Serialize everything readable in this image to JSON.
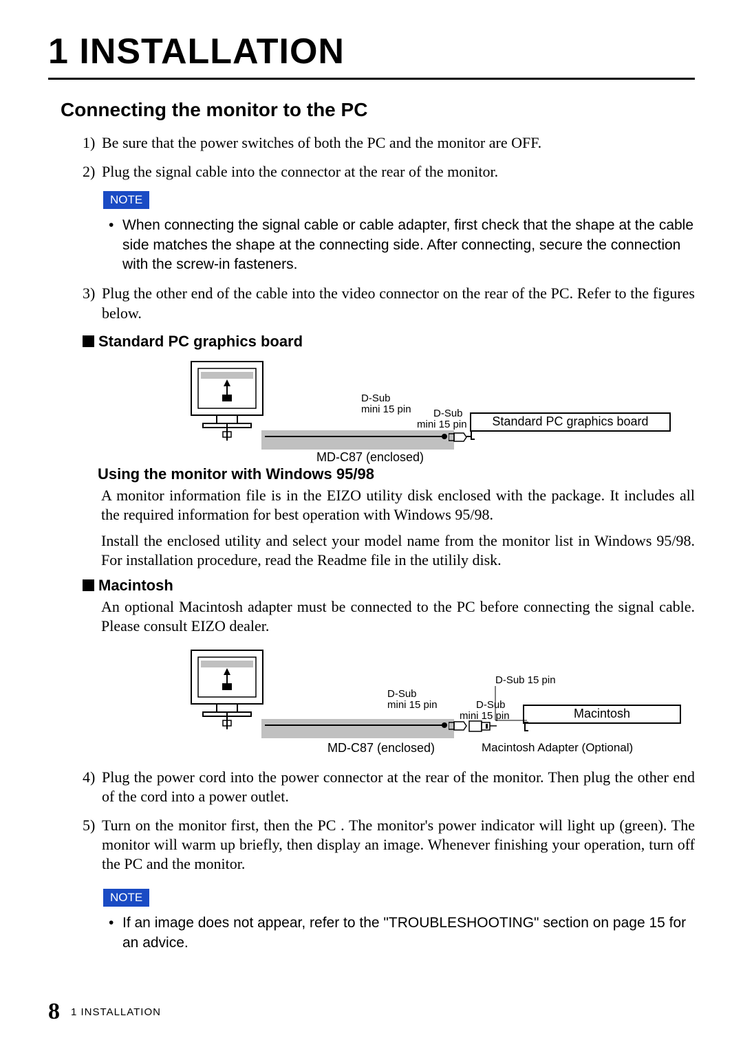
{
  "chapter": {
    "number": "1",
    "title": "INSTALLATION",
    "full": "1 INSTALLATION"
  },
  "section": {
    "heading": "Connecting the monitor to the PC"
  },
  "steps": {
    "s1": {
      "n": "1)",
      "t": "Be sure that the power switches of both the PC and the monitor are OFF."
    },
    "s2": {
      "n": "2)",
      "t": "Plug the signal cable into the connector at the rear of the monitor."
    },
    "s3": {
      "n": "3)",
      "t": "Plug the other end of the cable into the video connector on the rear of the PC.  Refer to the figures below."
    },
    "s4": {
      "n": "4)",
      "t": "Plug the power cord into the power connector at the rear of the monitor.  Then plug the other end of the cord into a power outlet."
    },
    "s5": {
      "n": "5)",
      "t": "Turn on the monitor first, then the PC .  The monitor's power indicator will light up (green).  The monitor will warm up briefly, then display an image.  Whenever finishing your operation, turn off the PC and the monitor."
    }
  },
  "notes": {
    "label": "NOTE",
    "n1": "When connecting the signal cable or cable adapter, first check that the shape at the cable side matches the shape at the connecting side.  After connecting, secure the connection with the screw-in fasteners.",
    "n2": "If an image does not appear, refer to the \"TROUBLESHOOTING\" section on page 15 for an advice."
  },
  "subheads": {
    "spc": "Standard PC graphics board",
    "win": "Using the monitor with Windows 95/98",
    "mac": "Macintosh"
  },
  "paras": {
    "win1": "A monitor information file is in the EIZO utility disk enclosed with the package.  It includes all the required information for best operation with Windows 95/98.",
    "win2": "Install the enclosed utility and select your model name from the monitor list in Windows 95/98.  For installation procedure, read the Readme file in the utilily disk.",
    "mac1": "An optional Macintosh adapter must be connected to the PC before connecting the signal cable.  Please consult EIZO dealer."
  },
  "diagram": {
    "dsub": "D-Sub\nmini 15 pin",
    "dsub1": "D-Sub",
    "dsub2": "mini 15 pin",
    "dsub15": "D-Sub 15 pin",
    "mdc": "MD-C87 (enclosed)",
    "spc_box": "Standard PC graphics board",
    "mac_box": "Macintosh",
    "mac_adapter": "Macintosh Adapter (Optional)"
  },
  "footer": {
    "page": "8",
    "label": "1   INSTALLATION"
  }
}
